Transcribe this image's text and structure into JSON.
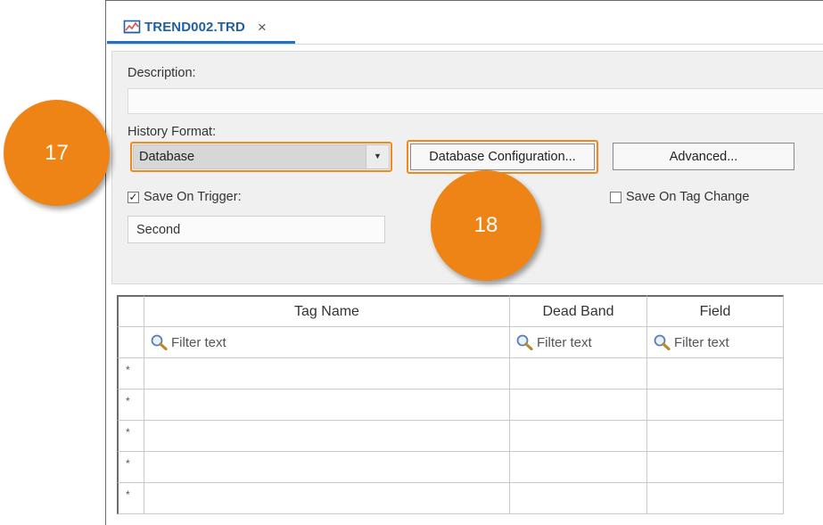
{
  "tab": {
    "title": "TREND002.TRD",
    "close_symbol": "×",
    "icon": "trend-chart-icon"
  },
  "description": {
    "label": "Description:",
    "value": ""
  },
  "history_format": {
    "label": "History Format:",
    "value": "Database"
  },
  "buttons": {
    "database_configuration": "Database Configuration...",
    "advanced": "Advanced..."
  },
  "save_on_trigger": {
    "label": "Save On Trigger:",
    "checked": true,
    "value": "Second"
  },
  "save_on_tag_change": {
    "label": "Save On Tag Change",
    "checked": false
  },
  "grid": {
    "columns": [
      "Tag Name",
      "Dead Band",
      "Field"
    ],
    "filter_placeholder": "Filter text",
    "new_row_marker": "*",
    "rows": [
      {
        "marker": "*",
        "cells": [
          "",
          "",
          ""
        ]
      },
      {
        "marker": "*",
        "cells": [
          "",
          "",
          ""
        ]
      },
      {
        "marker": "*",
        "cells": [
          "",
          "",
          ""
        ]
      },
      {
        "marker": "*",
        "cells": [
          "",
          "",
          ""
        ]
      },
      {
        "marker": "*",
        "cells": [
          "",
          "",
          ""
        ]
      }
    ]
  },
  "callouts": {
    "first": "17",
    "second": "18"
  },
  "colors": {
    "accent_blue": "#1e73c8",
    "tab_text": "#1f5fa8",
    "callout_orange": "#ee8416",
    "highlight_orange": "#f08a1e"
  }
}
